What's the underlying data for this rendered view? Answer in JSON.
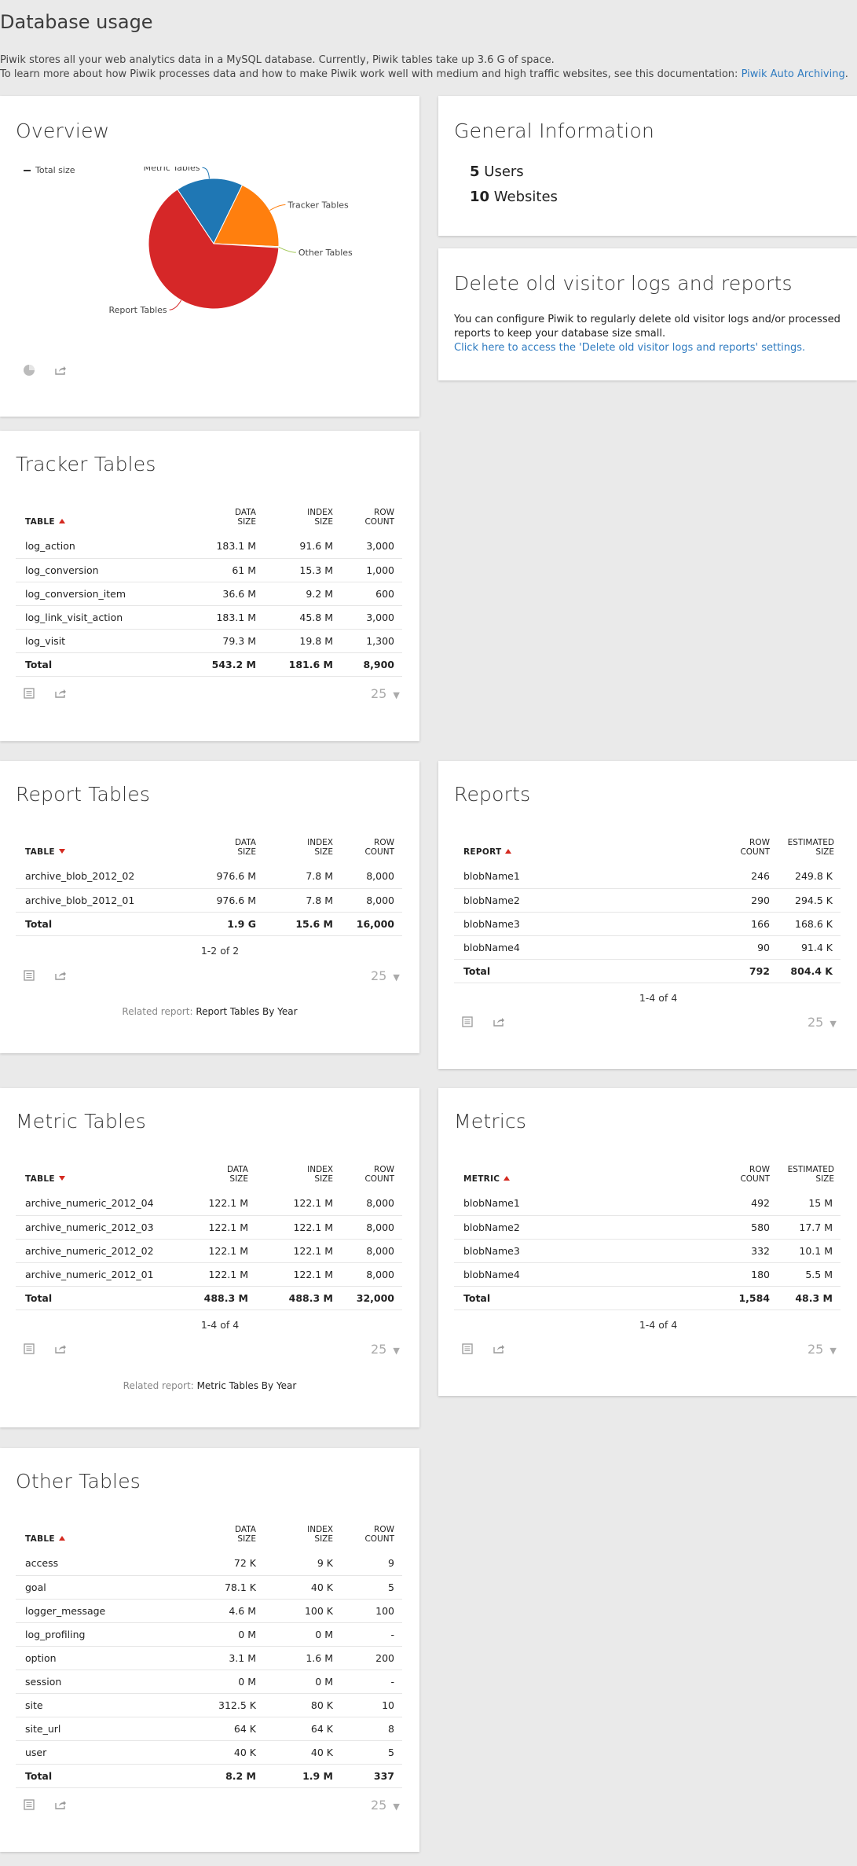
{
  "page": {
    "title": "Database usage",
    "intro_line1": "Piwik stores all your web analytics data in a MySQL database. Currently, Piwik tables take up 3.6 G of space.",
    "intro_line2_prefix": "To learn more about how Piwik processes data and how to make Piwik work well with medium and high traffic websites, see this documentation:",
    "intro_link": "Piwik Auto Archiving",
    "intro_suffix": "."
  },
  "overview": {
    "title": "Overview",
    "legend": "Total size",
    "chart_data": {
      "type": "pie",
      "categories": [
        "Metric Tables",
        "Tracker Tables",
        "Other Tables",
        "Report Tables"
      ],
      "values": [
        488.3,
        543.2,
        8.2,
        1900
      ],
      "unit": "M",
      "colors": [
        "#1f77b4",
        "#ff7f0e",
        "#a4c95b",
        "#d62728"
      ],
      "legend_position": "top-left"
    }
  },
  "general": {
    "title": "General Information",
    "users_count": "5",
    "users_label": "Users",
    "websites_count": "10",
    "websites_label": "Websites"
  },
  "delete_logs": {
    "title": "Delete old visitor logs and reports",
    "text": "You can configure Piwik to regularly delete old visitor logs and/or processed reports to keep your database size small.",
    "link": "Click here to access the 'Delete old visitor logs and reports' settings."
  },
  "tracker": {
    "title": "Tracker Tables",
    "headers": {
      "table": "TABLE",
      "data_l1": "DATA",
      "data_l2": "SIZE",
      "index_l1": "INDEX",
      "index_l2": "SIZE",
      "row_l1": "ROW",
      "row_l2": "COUNT"
    },
    "rows": [
      {
        "name": "log_action",
        "data": "183.1 M",
        "index": "91.6 M",
        "rows": "3,000"
      },
      {
        "name": "log_conversion",
        "data": "61 M",
        "index": "15.3 M",
        "rows": "1,000"
      },
      {
        "name": "log_conversion_item",
        "data": "36.6 M",
        "index": "9.2 M",
        "rows": "600"
      },
      {
        "name": "log_link_visit_action",
        "data": "183.1 M",
        "index": "45.8 M",
        "rows": "3,000"
      },
      {
        "name": "log_visit",
        "data": "79.3 M",
        "index": "19.8 M",
        "rows": "1,300"
      }
    ],
    "total": {
      "name": "Total",
      "data": "543.2 M",
      "index": "181.6 M",
      "rows": "8,900"
    },
    "limit": "25"
  },
  "report_tables": {
    "title": "Report Tables",
    "headers": {
      "table": "TABLE",
      "data_l1": "DATA",
      "data_l2": "SIZE",
      "index_l1": "INDEX",
      "index_l2": "SIZE",
      "row_l1": "ROW",
      "row_l2": "COUNT"
    },
    "rows": [
      {
        "name": "archive_blob_2012_02",
        "data": "976.6 M",
        "index": "7.8 M",
        "rows": "8,000"
      },
      {
        "name": "archive_blob_2012_01",
        "data": "976.6 M",
        "index": "7.8 M",
        "rows": "8,000"
      }
    ],
    "total": {
      "name": "Total",
      "data": "1.9 G",
      "index": "15.6 M",
      "rows": "16,000"
    },
    "pager": "1-2 of 2",
    "limit": "25",
    "related_prefix": "Related report:",
    "related_link": "Report Tables By Year"
  },
  "reports": {
    "title": "Reports",
    "headers": {
      "report": "REPORT",
      "row_l1": "ROW",
      "row_l2": "COUNT",
      "est_l1": "ESTIMATED",
      "est_l2": "SIZE"
    },
    "rows": [
      {
        "name": "blobName1",
        "rows": "246",
        "size": "249.8 K"
      },
      {
        "name": "blobName2",
        "rows": "290",
        "size": "294.5 K"
      },
      {
        "name": "blobName3",
        "rows": "166",
        "size": "168.6 K"
      },
      {
        "name": "blobName4",
        "rows": "90",
        "size": "91.4 K"
      }
    ],
    "total": {
      "name": "Total",
      "rows": "792",
      "size": "804.4 K"
    },
    "pager": "1-4 of 4",
    "limit": "25"
  },
  "metric_tables": {
    "title": "Metric Tables",
    "headers": {
      "table": "TABLE",
      "data_l1": "DATA",
      "data_l2": "SIZE",
      "index_l1": "INDEX",
      "index_l2": "SIZE",
      "row_l1": "ROW",
      "row_l2": "COUNT"
    },
    "rows": [
      {
        "name": "archive_numeric_2012_04",
        "data": "122.1 M",
        "index": "122.1 M",
        "rows": "8,000"
      },
      {
        "name": "archive_numeric_2012_03",
        "data": "122.1 M",
        "index": "122.1 M",
        "rows": "8,000"
      },
      {
        "name": "archive_numeric_2012_02",
        "data": "122.1 M",
        "index": "122.1 M",
        "rows": "8,000"
      },
      {
        "name": "archive_numeric_2012_01",
        "data": "122.1 M",
        "index": "122.1 M",
        "rows": "8,000"
      }
    ],
    "total": {
      "name": "Total",
      "data": "488.3 M",
      "index": "488.3 M",
      "rows": "32,000"
    },
    "pager": "1-4 of 4",
    "limit": "25",
    "related_prefix": "Related report:",
    "related_link": "Metric Tables By Year"
  },
  "metrics": {
    "title": "Metrics",
    "headers": {
      "metric": "METRIC",
      "row_l1": "ROW",
      "row_l2": "COUNT",
      "est_l1": "ESTIMATED",
      "est_l2": "SIZE"
    },
    "rows": [
      {
        "name": "blobName1",
        "rows": "492",
        "size": "15 M"
      },
      {
        "name": "blobName2",
        "rows": "580",
        "size": "17.7 M"
      },
      {
        "name": "blobName3",
        "rows": "332",
        "size": "10.1 M"
      },
      {
        "name": "blobName4",
        "rows": "180",
        "size": "5.5 M"
      }
    ],
    "total": {
      "name": "Total",
      "rows": "1,584",
      "size": "48.3 M"
    },
    "pager": "1-4 of 4",
    "limit": "25"
  },
  "other_tables": {
    "title": "Other Tables",
    "headers": {
      "table": "TABLE",
      "data_l1": "DATA",
      "data_l2": "SIZE",
      "index_l1": "INDEX",
      "index_l2": "SIZE",
      "row_l1": "ROW",
      "row_l2": "COUNT"
    },
    "rows": [
      {
        "name": "access",
        "data": "72 K",
        "index": "9 K",
        "rows": "9"
      },
      {
        "name": "goal",
        "data": "78.1 K",
        "index": "40 K",
        "rows": "5"
      },
      {
        "name": "logger_message",
        "data": "4.6 M",
        "index": "100 K",
        "rows": "100"
      },
      {
        "name": "log_profiling",
        "data": "0 M",
        "index": "0 M",
        "rows": "-"
      },
      {
        "name": "option",
        "data": "3.1 M",
        "index": "1.6 M",
        "rows": "200"
      },
      {
        "name": "session",
        "data": "0 M",
        "index": "0 M",
        "rows": "-"
      },
      {
        "name": "site",
        "data": "312.5 K",
        "index": "80 K",
        "rows": "10"
      },
      {
        "name": "site_url",
        "data": "64 K",
        "index": "64 K",
        "rows": "8"
      },
      {
        "name": "user",
        "data": "40 K",
        "index": "40 K",
        "rows": "5"
      }
    ],
    "total": {
      "name": "Total",
      "data": "8.2 M",
      "index": "1.9 M",
      "rows": "337"
    },
    "limit": "25"
  }
}
